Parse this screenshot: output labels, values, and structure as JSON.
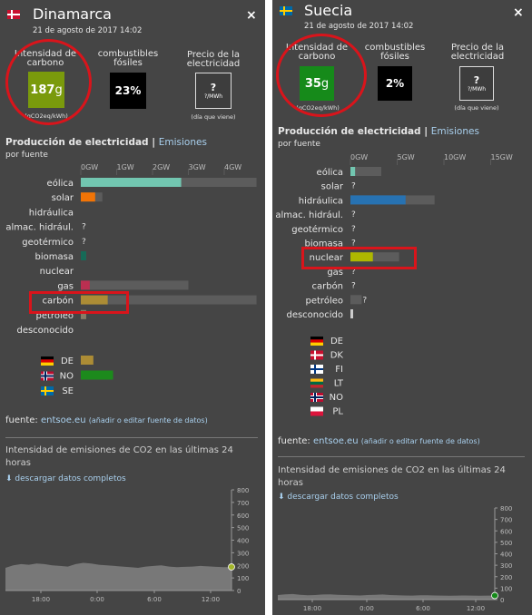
{
  "left": {
    "country": "Dinamarca",
    "datetime": "21 de agosto de 2017 14:02",
    "close": "×",
    "kpis": {
      "carbon_label": "Intensidad de carbono",
      "carbon_value": "187",
      "carbon_unit": "g",
      "carbon_unit_note": "(gCO2eq/kWh)",
      "carbon_color": "#7a9a0c",
      "fossil_label": "combustibles fósiles",
      "fossil_value": "23%",
      "price_label": "Precio de la electricidad",
      "price_value": "?",
      "price_unit": "?/MWh",
      "price_note": "(día que viene)"
    },
    "section_title": "Producción de electricidad",
    "section_sep": "|",
    "section_link": "Emisiones",
    "by_source": "por fuente",
    "axis": [
      "0GW",
      "1GW",
      "2GW",
      "3GW",
      "4GW"
    ],
    "rows": [
      {
        "label": "eólica",
        "value_gw": 2.8,
        "capacity_gw": 4.9,
        "color": "#72c6b0",
        "known": true
      },
      {
        "label": "solar",
        "value_gw": 0.4,
        "capacity_gw": 0.6,
        "color": "#f27406",
        "known": true
      },
      {
        "label": "hidráulica",
        "value_gw": 0,
        "capacity_gw": 0,
        "color": "#2772b2",
        "known": true
      },
      {
        "label": "almac. hidrául.",
        "value_gw": 0,
        "capacity_gw": 0,
        "color": "#0052cc",
        "known": false,
        "mark": "?"
      },
      {
        "label": "geotérmico",
        "value_gw": 0,
        "capacity_gw": 0,
        "color": "#ffcc00",
        "known": false,
        "mark": "?"
      },
      {
        "label": "biomasa",
        "value_gw": 0.15,
        "capacity_gw": 0.15,
        "color": "#166a57",
        "known": true
      },
      {
        "label": "nuclear",
        "value_gw": 0,
        "capacity_gw": 0,
        "color": "#aeb800",
        "known": true
      },
      {
        "label": "gas",
        "value_gw": 0.25,
        "capacity_gw": 3.0,
        "color": "#bb2f51",
        "known": true
      },
      {
        "label": "carbón",
        "value_gw": 0.75,
        "capacity_gw": 4.9,
        "color": "#ac8c35",
        "known": true
      },
      {
        "label": "petróleo",
        "value_gw": 0.15,
        "capacity_gw": 0.15,
        "color": "#867d66",
        "known": true
      },
      {
        "label": "desconocido",
        "value_gw": 0,
        "capacity_gw": 0,
        "color": "#cccccc",
        "known": true
      }
    ],
    "exchanges": [
      {
        "code": "DE",
        "flag": "de",
        "value_gw": 0.35,
        "color": "#ac8c35"
      },
      {
        "code": "NO",
        "flag": "no",
        "value_gw": 0.9,
        "color": "#1c8a1c"
      },
      {
        "code": "SE",
        "flag": "se",
        "value_gw": 0,
        "color": "#1c8a1c"
      }
    ],
    "source_label": "fuente:",
    "source_link": "entsoe.eu",
    "source_edit": "(añadir o editar fuente de datos)",
    "history_title": "Intensidad de emisiones de CO2 en las últimas 24 horas",
    "download": "descargar datos completos",
    "history_y": [
      "800",
      "700",
      "600",
      "500",
      "400",
      "300",
      "200",
      "100",
      "0"
    ],
    "history_x": [
      "18:00",
      "0:00",
      "6:00",
      "12:00"
    ]
  },
  "right": {
    "country": "Suecia",
    "datetime": "21 de agosto de 2017 14:02",
    "close": "×",
    "kpis": {
      "carbon_label": "Intensidad de carbono",
      "carbon_value": "35",
      "carbon_unit": "g",
      "carbon_unit_note": "(gCO2eq/kWh)",
      "carbon_color": "#168a1a",
      "fossil_label": "combustibles fósiles",
      "fossil_value": "2%",
      "price_label": "Precio de la electricidad",
      "price_value": "?",
      "price_unit": "?/MWh",
      "price_note": "(día que viene)"
    },
    "section_title": "Producción de electricidad",
    "section_sep": "|",
    "section_link": "Emisiones",
    "by_source": "por fuente",
    "axis": [
      "0GW",
      "5GW",
      "10GW",
      "15GW"
    ],
    "rows": [
      {
        "label": "eólica",
        "value_gw": 0.5,
        "capacity_gw": 3.3,
        "color": "#72c6b0",
        "known": true
      },
      {
        "label": "solar",
        "value_gw": 0,
        "capacity_gw": 0,
        "color": "#f27406",
        "known": false,
        "mark": "?"
      },
      {
        "label": "hidráulica",
        "value_gw": 5.9,
        "capacity_gw": 9.0,
        "color": "#2772b2",
        "known": true
      },
      {
        "label": "almac. hidrául.",
        "value_gw": 0,
        "capacity_gw": 0,
        "color": "#0052cc",
        "known": false,
        "mark": "?"
      },
      {
        "label": "geotérmico",
        "value_gw": 0,
        "capacity_gw": 0,
        "color": "#ffcc00",
        "known": false,
        "mark": "?"
      },
      {
        "label": "biomasa",
        "value_gw": 0,
        "capacity_gw": 0,
        "color": "#166a57",
        "known": false,
        "mark": "?"
      },
      {
        "label": "nuclear",
        "value_gw": 2.4,
        "capacity_gw": 5.2,
        "color": "#aeb800",
        "known": true
      },
      {
        "label": "gas",
        "value_gw": 0,
        "capacity_gw": 0,
        "color": "#bb2f51",
        "known": false,
        "mark": "?"
      },
      {
        "label": "carbón",
        "value_gw": 0,
        "capacity_gw": 0,
        "color": "#ac8c35",
        "known": false,
        "mark": "?"
      },
      {
        "label": "petróleo",
        "value_gw": 0,
        "capacity_gw": 1.2,
        "color": "#867d66",
        "known": false,
        "mark": "?"
      },
      {
        "label": "desconocido",
        "value_gw": 0.2,
        "capacity_gw": 0.2,
        "color": "#cccccc",
        "known": true
      }
    ],
    "exchanges": [
      {
        "code": "DE",
        "flag": "de"
      },
      {
        "code": "DK",
        "flag": "dk"
      },
      {
        "code": "FI",
        "flag": "fi"
      },
      {
        "code": "LT",
        "flag": "lt"
      },
      {
        "code": "NO",
        "flag": "no"
      },
      {
        "code": "PL",
        "flag": "pl"
      }
    ],
    "source_label": "fuente:",
    "source_link": "entsoe.eu",
    "source_edit": "(añadir o editar fuente de datos)",
    "history_title": "Intensidad de emisiones de CO2 en las últimas 24 horas",
    "download": "descargar datos completos",
    "history_y": [
      "800",
      "700",
      "600",
      "500",
      "400",
      "300",
      "200",
      "100",
      "0"
    ],
    "history_x": [
      "18:00",
      "0:00",
      "6:00",
      "12:00"
    ]
  }
}
